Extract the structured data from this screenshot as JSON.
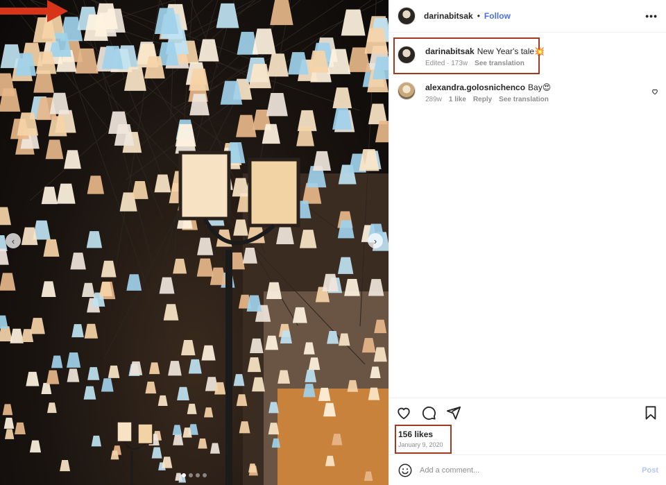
{
  "post": {
    "username": "darinabitsak",
    "follow_label": "Follow",
    "separator": "•",
    "more_icon": "more-horizontal-icon"
  },
  "caption": {
    "username": "darinabitsak",
    "text": "New Year's tale💥",
    "edited": "Edited · 173w",
    "see_translation": "See translation"
  },
  "comments": [
    {
      "username": "alexandra.golosnichenco",
      "text": "Bay😍",
      "age": "289w",
      "likes": "1 like",
      "reply": "Reply",
      "see_translation": "See translation"
    }
  ],
  "actions": {
    "likes": "156 likes",
    "date": "January 9, 2020",
    "icons": [
      "heart-icon",
      "comment-icon",
      "share-icon",
      "bookmark-icon"
    ]
  },
  "comment_bar": {
    "placeholder": "Add a comment...",
    "post_label": "Post"
  },
  "colors": {
    "follow": "#4a6fd9",
    "highlight": "#a4381f",
    "post_disabled": "#b3c6f2"
  }
}
